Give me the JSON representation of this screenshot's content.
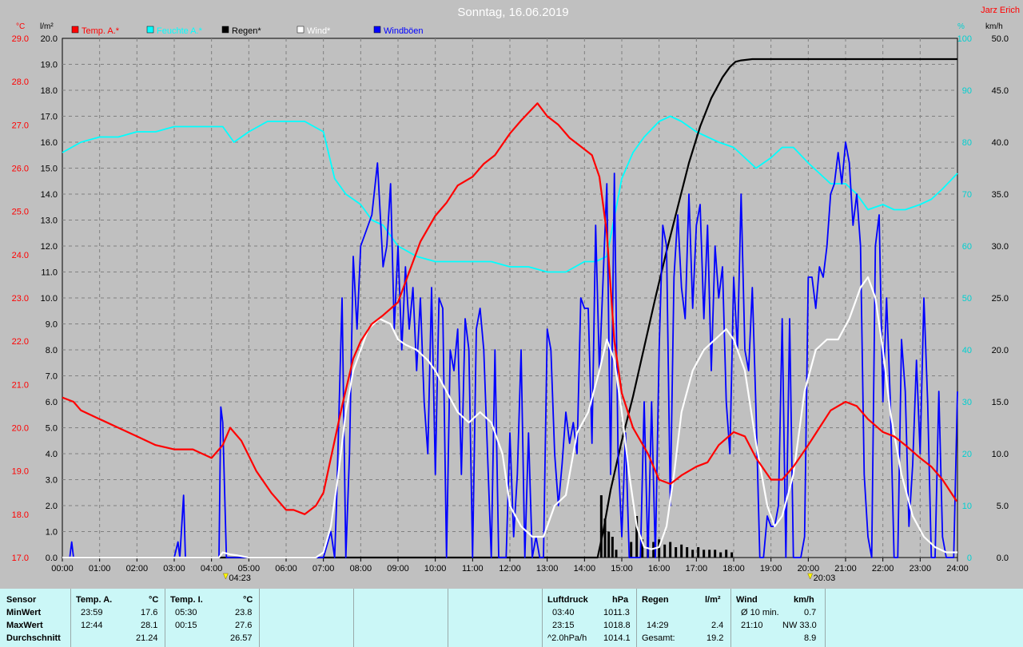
{
  "title": "Sonntag, 16.06.2019",
  "author": "Jarz Erich",
  "units": {
    "left_temp": "°C",
    "left_rain": "l/m²",
    "right_pct": "%",
    "right_wind": "km/h"
  },
  "legend": [
    {
      "label": "Temp. A.*",
      "color": "#ff0000"
    },
    {
      "label": "Feuchte A.*",
      "color": "#00ffff"
    },
    {
      "label": "Regen*",
      "color": "#000000"
    },
    {
      "label": "Wind*",
      "color": "#ffffff"
    },
    {
      "label": "Windböen",
      "color": "#0000ff"
    }
  ],
  "markers": [
    {
      "label": "04:23",
      "hour": 4.38
    },
    {
      "label": "20:03",
      "hour": 20.05
    }
  ],
  "chart_data": {
    "type": "line",
    "x_ticks": [
      "00:00",
      "01:00",
      "02:00",
      "03:00",
      "04:00",
      "05:00",
      "06:00",
      "07:00",
      "08:00",
      "09:00",
      "10:00",
      "11:00",
      "12:00",
      "13:00",
      "14:00",
      "15:00",
      "16:00",
      "17:00",
      "18:00",
      "19:00",
      "20:00",
      "21:00",
      "22:00",
      "23:00",
      "24:00"
    ],
    "axes": {
      "temp": {
        "range": [
          17.0,
          29.0
        ],
        "ticks": [
          "17.0",
          "18.0",
          "19.0",
          "20.0",
          "21.0",
          "22.0",
          "23.0",
          "24.0",
          "25.0",
          "26.0",
          "27.0",
          "28.0",
          "29.0"
        ],
        "color": "#ff0000"
      },
      "rain": {
        "range": [
          0,
          20
        ],
        "ticks": [
          "0.0",
          "1.0",
          "2.0",
          "3.0",
          "4.0",
          "5.0",
          "6.0",
          "7.0",
          "8.0",
          "9.0",
          "10.0",
          "11.0",
          "12.0",
          "13.0",
          "14.0",
          "15.0",
          "16.0",
          "17.0",
          "18.0",
          "19.0",
          "20.0"
        ],
        "color": "#000000"
      },
      "humidity": {
        "range": [
          0,
          100
        ],
        "ticks": [
          "0",
          "10",
          "20",
          "30",
          "40",
          "50",
          "60",
          "70",
          "80",
          "90",
          "100"
        ],
        "color": "#00d0d0"
      },
      "wind": {
        "range": [
          0,
          50
        ],
        "ticks": [
          "0.0",
          "5.0",
          "10.0",
          "15.0",
          "20.0",
          "25.0",
          "30.0",
          "35.0",
          "40.0",
          "45.0",
          "50.0"
        ],
        "color": "#000000"
      }
    },
    "series": [
      {
        "name": "Temp. A.*",
        "axis": "temp",
        "color": "#ff0000",
        "x": [
          0,
          0.3,
          0.5,
          1,
          1.5,
          2,
          2.5,
          3,
          3.5,
          4,
          4.3,
          4.5,
          4.8,
          5.2,
          5.6,
          6,
          6.2,
          6.5,
          6.8,
          7,
          7.2,
          7.5,
          7.8,
          8,
          8.3,
          8.6,
          9,
          9.3,
          9.6,
          10,
          10.3,
          10.6,
          11,
          11.3,
          11.6,
          12,
          12.3,
          12.74,
          13,
          13.3,
          13.6,
          13.9,
          14.2,
          14.4,
          14.6,
          14.8,
          15,
          15.3,
          15.7,
          16,
          16.3,
          16.6,
          17,
          17.3,
          17.6,
          18,
          18.3,
          18.6,
          19,
          19.3,
          19.6,
          20,
          20.3,
          20.6,
          21,
          21.3,
          21.6,
          22,
          22.3,
          22.6,
          23,
          23.3,
          23.6,
          23.98
        ],
        "y": [
          20.7,
          20.6,
          20.4,
          20.2,
          20.0,
          19.8,
          19.6,
          19.5,
          19.5,
          19.3,
          19.6,
          20.0,
          19.7,
          19.0,
          18.5,
          18.1,
          18.1,
          18.0,
          18.2,
          18.5,
          19.3,
          20.5,
          21.6,
          22.0,
          22.4,
          22.6,
          22.9,
          23.6,
          24.3,
          24.9,
          25.2,
          25.6,
          25.8,
          26.1,
          26.3,
          26.8,
          27.1,
          27.5,
          27.2,
          27.0,
          26.7,
          26.5,
          26.3,
          25.8,
          24.5,
          22.0,
          20.8,
          20.0,
          19.4,
          18.8,
          18.7,
          18.9,
          19.1,
          19.2,
          19.6,
          19.9,
          19.8,
          19.3,
          18.8,
          18.8,
          19.1,
          19.6,
          20.0,
          20.4,
          20.6,
          20.5,
          20.2,
          19.9,
          19.8,
          19.6,
          19.3,
          19.1,
          18.8,
          18.3
        ]
      },
      {
        "name": "Feuchte A.*",
        "axis": "humidity",
        "color": "#00ffff",
        "x": [
          0,
          0.5,
          1,
          1.5,
          2,
          2.5,
          3,
          3.5,
          4,
          4.3,
          4.6,
          5,
          5.5,
          6,
          6.5,
          7,
          7.3,
          7.6,
          8,
          8.3,
          8.6,
          9,
          9.5,
          10,
          10.5,
          11,
          11.5,
          12,
          12.5,
          13,
          13.5,
          14,
          14.3,
          14.6,
          15,
          15.3,
          15.6,
          16,
          16.3,
          16.6,
          17,
          17.3,
          17.6,
          18,
          18.3,
          18.6,
          19,
          19.3,
          19.6,
          20,
          20.3,
          20.6,
          21,
          21.3,
          21.6,
          22,
          22.3,
          22.6,
          23,
          23.3,
          23.6,
          24
        ],
        "y": [
          78,
          80,
          81,
          81,
          82,
          82,
          83,
          83,
          83,
          83,
          80,
          82,
          84,
          84,
          84,
          82,
          73,
          70,
          68,
          65,
          64,
          60,
          58,
          57,
          57,
          57,
          57,
          56,
          56,
          55,
          55,
          57,
          57,
          58,
          73,
          78,
          81,
          84,
          85,
          84,
          82,
          81,
          80,
          79,
          77,
          75,
          77,
          79,
          79,
          76,
          74,
          72,
          72,
          70,
          67,
          68,
          67,
          67,
          68,
          69,
          71,
          74
        ]
      },
      {
        "name": "Regen*",
        "axis": "rain",
        "color": "#000000",
        "x": [
          0,
          14.35,
          14.5,
          14.7,
          15,
          15.3,
          15.6,
          15.9,
          16.2,
          16.5,
          16.8,
          17.1,
          17.4,
          17.7,
          17.9,
          18.05,
          18.2,
          18.5,
          19,
          19.5,
          20,
          21,
          22,
          23,
          24
        ],
        "y": [
          0,
          0,
          1.0,
          2.6,
          4.5,
          6.2,
          8.1,
          10.0,
          11.8,
          13.5,
          15.2,
          16.6,
          17.7,
          18.5,
          18.9,
          19.1,
          19.15,
          19.2,
          19.2,
          19.2,
          19.2,
          19.2,
          19.2,
          19.2,
          19.2
        ]
      },
      {
        "name": "Wind*",
        "axis": "wind",
        "color": "#ffffff",
        "x": [
          0,
          4.2,
          4.3,
          4.5,
          4.7,
          5.0,
          6.8,
          7.0,
          7.2,
          7.4,
          7.6,
          7.8,
          8.0,
          8.2,
          8.5,
          8.8,
          9.0,
          9.2,
          9.5,
          9.8,
          10.0,
          10.3,
          10.6,
          10.9,
          11.2,
          11.5,
          11.8,
          12.0,
          12.3,
          12.6,
          12.9,
          13.2,
          13.5,
          13.8,
          14.1,
          14.4,
          14.6,
          14.8,
          15.0,
          15.2,
          15.4,
          15.6,
          15.8,
          16.0,
          16.2,
          16.4,
          16.6,
          16.9,
          17.2,
          17.5,
          17.8,
          18.0,
          18.3,
          18.6,
          18.9,
          19.1,
          19.3,
          19.6,
          19.9,
          20.2,
          20.5,
          20.8,
          21.1,
          21.4,
          21.6,
          21.8,
          22.0,
          22.2,
          22.5,
          22.8,
          23.1,
          23.4,
          23.7,
          24.0
        ],
        "y": [
          0,
          0,
          0.5,
          0.3,
          0.2,
          0,
          0,
          0.5,
          3,
          8,
          14,
          18,
          20,
          22,
          23,
          22.5,
          21,
          20.5,
          20,
          19,
          18,
          16,
          14,
          13,
          14,
          13,
          10,
          5,
          3,
          2,
          2,
          5,
          6,
          12,
          14,
          18,
          21,
          19,
          14,
          8,
          3,
          1,
          0.8,
          1,
          3,
          8,
          14,
          18,
          20,
          21,
          22,
          21,
          18,
          11,
          5,
          3,
          4,
          8,
          16,
          20,
          21,
          21,
          23,
          26,
          27,
          25,
          20,
          14,
          8,
          4,
          2,
          1,
          0.5,
          0.5
        ]
      },
      {
        "name": "Windböen",
        "axis": "wind",
        "color": "#0000ff",
        "x": [
          0,
          0.2,
          0.25,
          0.3,
          3,
          3.1,
          3.15,
          3.25,
          3.3,
          3.35,
          3.4,
          4.1,
          4.2,
          4.25,
          4.3,
          4.4,
          4.45,
          7.0,
          7.2,
          7.3,
          7.35,
          7.5,
          7.6,
          7.7,
          7.8,
          7.9,
          8.0,
          8.1,
          8.3,
          8.45,
          8.6,
          8.7,
          8.8,
          8.9,
          9.0,
          9.1,
          9.2,
          9.3,
          9.4,
          9.5,
          9.6,
          9.7,
          9.8,
          9.9,
          10.0,
          10.1,
          10.2,
          10.3,
          10.4,
          10.5,
          10.6,
          10.7,
          10.8,
          10.9,
          11.0,
          11.1,
          11.2,
          11.3,
          11.4,
          11.5,
          11.6,
          11.7,
          11.8,
          11.9,
          12.0,
          12.1,
          12.2,
          12.3,
          12.4,
          12.5,
          12.6,
          12.7,
          12.8,
          12.9,
          13.0,
          13.1,
          13.2,
          13.3,
          13.4,
          13.5,
          13.6,
          13.7,
          13.8,
          13.9,
          14.0,
          14.1,
          14.2,
          14.3,
          14.4,
          14.5,
          14.6,
          14.7,
          14.8,
          14.9,
          15.0,
          15.1,
          15.2,
          15.3,
          15.4,
          15.5,
          15.6,
          15.7,
          15.8,
          15.9,
          16.0,
          16.1,
          16.2,
          16.3,
          16.4,
          16.5,
          16.6,
          16.7,
          16.8,
          16.9,
          17.0,
          17.1,
          17.2,
          17.3,
          17.4,
          17.5,
          17.6,
          17.7,
          17.8,
          17.9,
          18.0,
          18.1,
          18.2,
          18.3,
          18.4,
          18.5,
          18.6,
          18.7,
          18.8,
          18.9,
          19.0,
          19.1,
          19.2,
          19.3,
          19.4,
          19.5,
          19.6,
          19.7,
          19.8,
          19.9,
          20.0,
          20.1,
          20.2,
          20.3,
          20.4,
          20.5,
          20.6,
          20.7,
          20.8,
          20.9,
          21.0,
          21.1,
          21.2,
          21.3,
          21.4,
          21.5,
          21.6,
          21.7,
          21.8,
          21.9,
          22.0,
          22.1,
          22.2,
          22.3,
          22.4,
          22.5,
          22.6,
          22.7,
          22.8,
          22.9,
          23.0,
          23.1,
          23.2,
          23.3,
          23.4,
          23.5,
          23.6,
          23.7,
          23.8,
          23.9,
          24.0
        ],
        "y": [
          0,
          0,
          1.5,
          0,
          0,
          1.5,
          0,
          6,
          0,
          0,
          0,
          0,
          0,
          14.5,
          13,
          0,
          0,
          0,
          2.5,
          0,
          5,
          25,
          0,
          10,
          29,
          22,
          30,
          31,
          33,
          38,
          28,
          30,
          36,
          22,
          30,
          20,
          28,
          22,
          26,
          18,
          25,
          15,
          10,
          26,
          8,
          25,
          24,
          0,
          20,
          18,
          22,
          8,
          23,
          20,
          0,
          22,
          24,
          20,
          10,
          0,
          20,
          0,
          0,
          0,
          12,
          2,
          8,
          20,
          0,
          12,
          0,
          2,
          0,
          0,
          22,
          20,
          10,
          5,
          9,
          14,
          11,
          13,
          10,
          25,
          24,
          24,
          11,
          32,
          18,
          27,
          36,
          8,
          37,
          10,
          2,
          12,
          0,
          0,
          0,
          0,
          15,
          0,
          15,
          0,
          20,
          32,
          30,
          5,
          27,
          33,
          26,
          23,
          35,
          24,
          32,
          34,
          23,
          32,
          18,
          30,
          25,
          28,
          15,
          10,
          27,
          20,
          35,
          20,
          18,
          26,
          14,
          0,
          0,
          4,
          3,
          3,
          5,
          23,
          0,
          23,
          0,
          0,
          0,
          2,
          27,
          27,
          24,
          28,
          27,
          30,
          35,
          36,
          39,
          36,
          40,
          38,
          32,
          35,
          30,
          8,
          2,
          0,
          30,
          33,
          15,
          25,
          15,
          0,
          0,
          21,
          16,
          3,
          9,
          19,
          10,
          25,
          15,
          0,
          0,
          16,
          2,
          0,
          0,
          0,
          16
        ]
      }
    ],
    "rain_bars": {
      "x": [
        14.45,
        14.55,
        14.65,
        14.75,
        14.85,
        15.25,
        15.4,
        15.55,
        15.7,
        15.85,
        16.0,
        16.15,
        16.3,
        16.45,
        16.6,
        16.75,
        16.9,
        17.05,
        17.2,
        17.35,
        17.5,
        17.65,
        17.8,
        17.95
      ],
      "y": [
        2.4,
        1.5,
        1.0,
        0.8,
        0.3,
        0.6,
        1.6,
        0.7,
        0.8,
        0.6,
        0.7,
        0.5,
        0.6,
        0.4,
        0.5,
        0.4,
        0.3,
        0.4,
        0.3,
        0.3,
        0.3,
        0.2,
        0.3,
        0.2
      ]
    }
  },
  "stats": {
    "sensor": {
      "header": "Sensor",
      "rows": [
        "MinWert",
        "MaxWert",
        "Durchschnitt"
      ]
    },
    "temp_a": {
      "header": "Temp. A.",
      "unit": "°C",
      "min_time": "23:59",
      "min_val": "17.6",
      "max_time": "12:44",
      "max_val": "28.1",
      "avg": "21.24"
    },
    "temp_i": {
      "header": "Temp. I.",
      "unit": "°C",
      "min_time": "05:30",
      "min_val": "23.8",
      "max_time": "00:15",
      "max_val": "27.6",
      "avg": "26.57"
    },
    "pressure": {
      "header": "Luftdruck",
      "unit": "hPa",
      "min_time": "03:40",
      "min_val": "1011.3",
      "max_time": "23:15",
      "max_val": "1018.8",
      "trend_label": "^2.0hPa/h",
      "trend_val": "1014.1"
    },
    "rain": {
      "header": "Regen",
      "unit": "l/m²",
      "max_time": "14:29",
      "max_val": "2.4",
      "total_label": "Gesamt:",
      "total_val": "19.2"
    },
    "wind": {
      "header": "Wind",
      "unit": "km/h",
      "avg_label": "Ø 10 min.",
      "avg_val": "0.7",
      "max_time": "21:10",
      "max_val": "NW 33.0",
      "avg2": "8.9"
    }
  }
}
